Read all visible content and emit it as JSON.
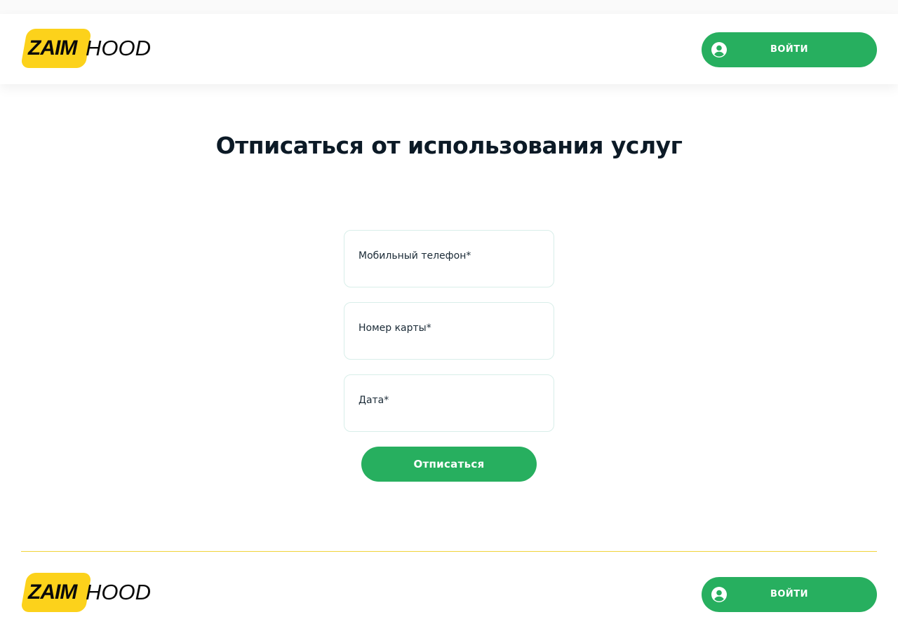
{
  "header": {
    "logo": {
      "part1": "ZAIM",
      "part2": "HOOD"
    },
    "login_label": "ВОЙТИ"
  },
  "main": {
    "title": "Отписаться от использования услуг",
    "fields": [
      {
        "label": "Мобильный телефон*",
        "value": ""
      },
      {
        "label": "Номер карты*",
        "value": ""
      },
      {
        "label": "Дата*",
        "value": ""
      }
    ],
    "submit_label": "Отписаться"
  },
  "footer": {
    "logo": {
      "part1": "ZAIM",
      "part2": "HOOD"
    },
    "login_label": "ВОЙТИ"
  },
  "colors": {
    "accent_green": "#27af5f",
    "brand_yellow": "#fcd21b",
    "title_dark": "#0c1a26",
    "field_border": "#d8eee9"
  },
  "icons": {
    "login": "user-circle-icon"
  }
}
